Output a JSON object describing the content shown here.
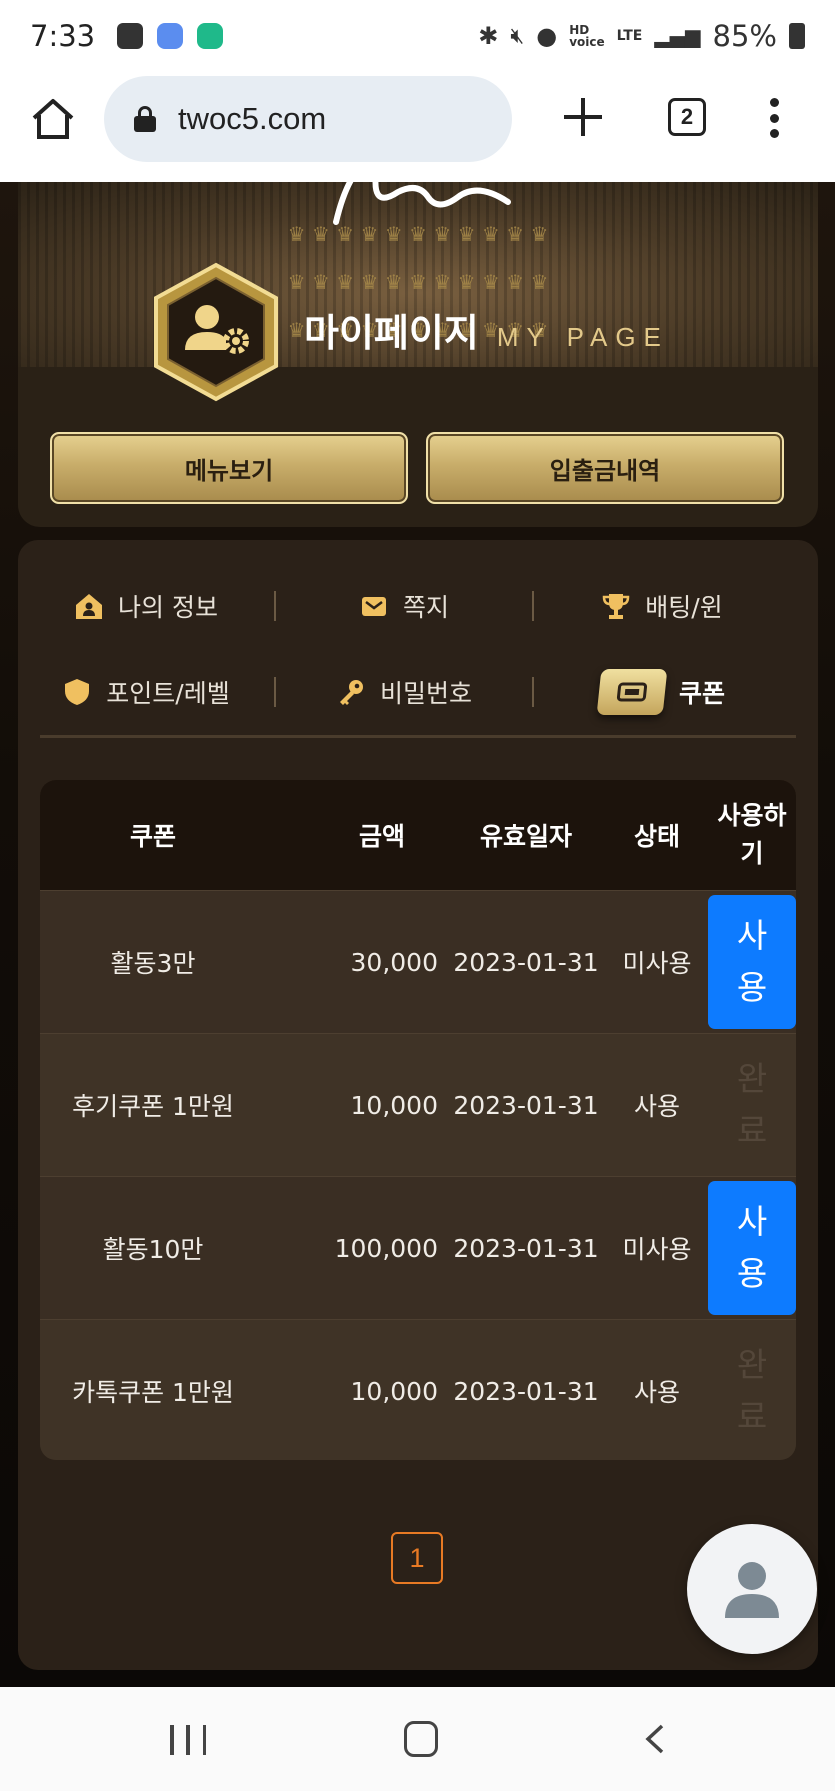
{
  "status_bar": {
    "time": "7:33",
    "network": "LTE",
    "battery": "85%"
  },
  "browser": {
    "url": "twoc5.com",
    "tab_count": "2"
  },
  "header": {
    "title_ko": "마이페이지",
    "title_en": "MY PAGE",
    "menu_button": "메뉴보기",
    "history_button": "입출금내역"
  },
  "nav": {
    "items": [
      {
        "label": "나의 정보",
        "icon": "home-icon"
      },
      {
        "label": "쪽지",
        "icon": "mail-icon"
      },
      {
        "label": "배팅/윈",
        "icon": "trophy-icon"
      },
      {
        "label": "포인트/레벨",
        "icon": "shield-icon"
      },
      {
        "label": "비밀번호",
        "icon": "key-icon"
      },
      {
        "label": "쿠폰",
        "icon": "ticket-icon",
        "active": true
      }
    ]
  },
  "table": {
    "headers": [
      "쿠폰",
      "금액",
      "유효일자",
      "상태",
      "사용하\n기"
    ],
    "header_use_line1": "사용하",
    "header_use_line2": "기",
    "rows": [
      {
        "name": "활동3만",
        "amount": "30,000",
        "date": "2023-01-31",
        "status": "미사용",
        "action": "사용",
        "action_l1": "사",
        "action_l2": "용"
      },
      {
        "name": "후기쿠폰 1만원",
        "amount": "10,000",
        "date": "2023-01-31",
        "status": "사용",
        "action": "완료",
        "action_l1": "완",
        "action_l2": "료"
      },
      {
        "name": "활동10만",
        "amount": "100,000",
        "date": "2023-01-31",
        "status": "미사용",
        "action": "사용",
        "action_l1": "사",
        "action_l2": "용"
      },
      {
        "name": "카톡쿠폰 1만원",
        "amount": "10,000",
        "date": "2023-01-31",
        "status": "사용",
        "action": "완료",
        "action_l1": "완",
        "action_l2": "료"
      }
    ]
  },
  "pagination": {
    "current": "1"
  },
  "colors": {
    "accent_gold": "#c8ad6a",
    "use_button": "#0d7bff",
    "pager": "#e87a24"
  }
}
